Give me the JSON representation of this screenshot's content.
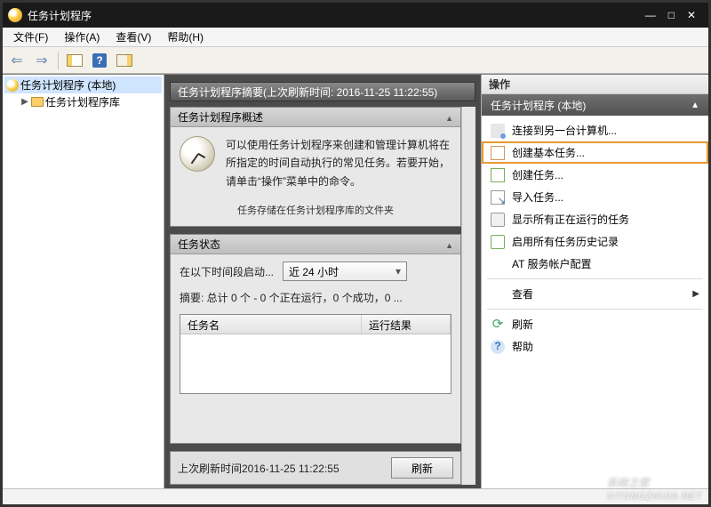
{
  "window": {
    "title": "任务计划程序"
  },
  "menus": {
    "file": "文件(F)",
    "action": "操作(A)",
    "view": "查看(V)",
    "help": "帮助(H)"
  },
  "tree": {
    "root": "任务计划程序 (本地)",
    "child": "任务计划程序库"
  },
  "center": {
    "header": "任务计划程序摘要(上次刷新时间: 2016-11-25 11:22:55)",
    "overview_title": "任务计划程序概述",
    "overview_text": "可以使用任务计划程序来创建和管理计算机将在所指定的时间自动执行的常见任务。若要开始，请单击“操作”菜单中的命令。",
    "overview_cut": "任务存储在任务计划程序库的文件夹",
    "status_title": "任务状态",
    "status_label": "在以下时间段启动...",
    "status_combo": "近 24 小时",
    "summary": "摘要: 总计 0 个 - 0 个正在运行，0 个成功，0 ...",
    "col_name": "任务名",
    "col_result": "运行结果",
    "last_refresh": "上次刷新时间2016-11-25 11:22:55",
    "refresh_btn": "刷新"
  },
  "actions": {
    "pane_title": "操作",
    "subtitle": "任务计划程序 (本地)",
    "items": [
      {
        "label": "连接到另一台计算机...",
        "icon": "connect"
      },
      {
        "label": "创建基本任务...",
        "icon": "doc",
        "highlight": true
      },
      {
        "label": "创建任务...",
        "icon": "doc-g"
      },
      {
        "label": "导入任务...",
        "icon": "import"
      },
      {
        "label": "显示所有正在运行的任务",
        "icon": "running"
      },
      {
        "label": "启用所有任务历史记录",
        "icon": "history"
      },
      {
        "label": "AT 服务帐户配置",
        "icon": "blank"
      },
      {
        "label": "查看",
        "icon": "blank",
        "arrow": true
      },
      {
        "label": "刷新",
        "icon": "refresh"
      },
      {
        "label": "帮助",
        "icon": "help"
      }
    ]
  },
  "watermark": {
    "big": "系统之家",
    "small": "XITONGZHIJIA.NET"
  }
}
